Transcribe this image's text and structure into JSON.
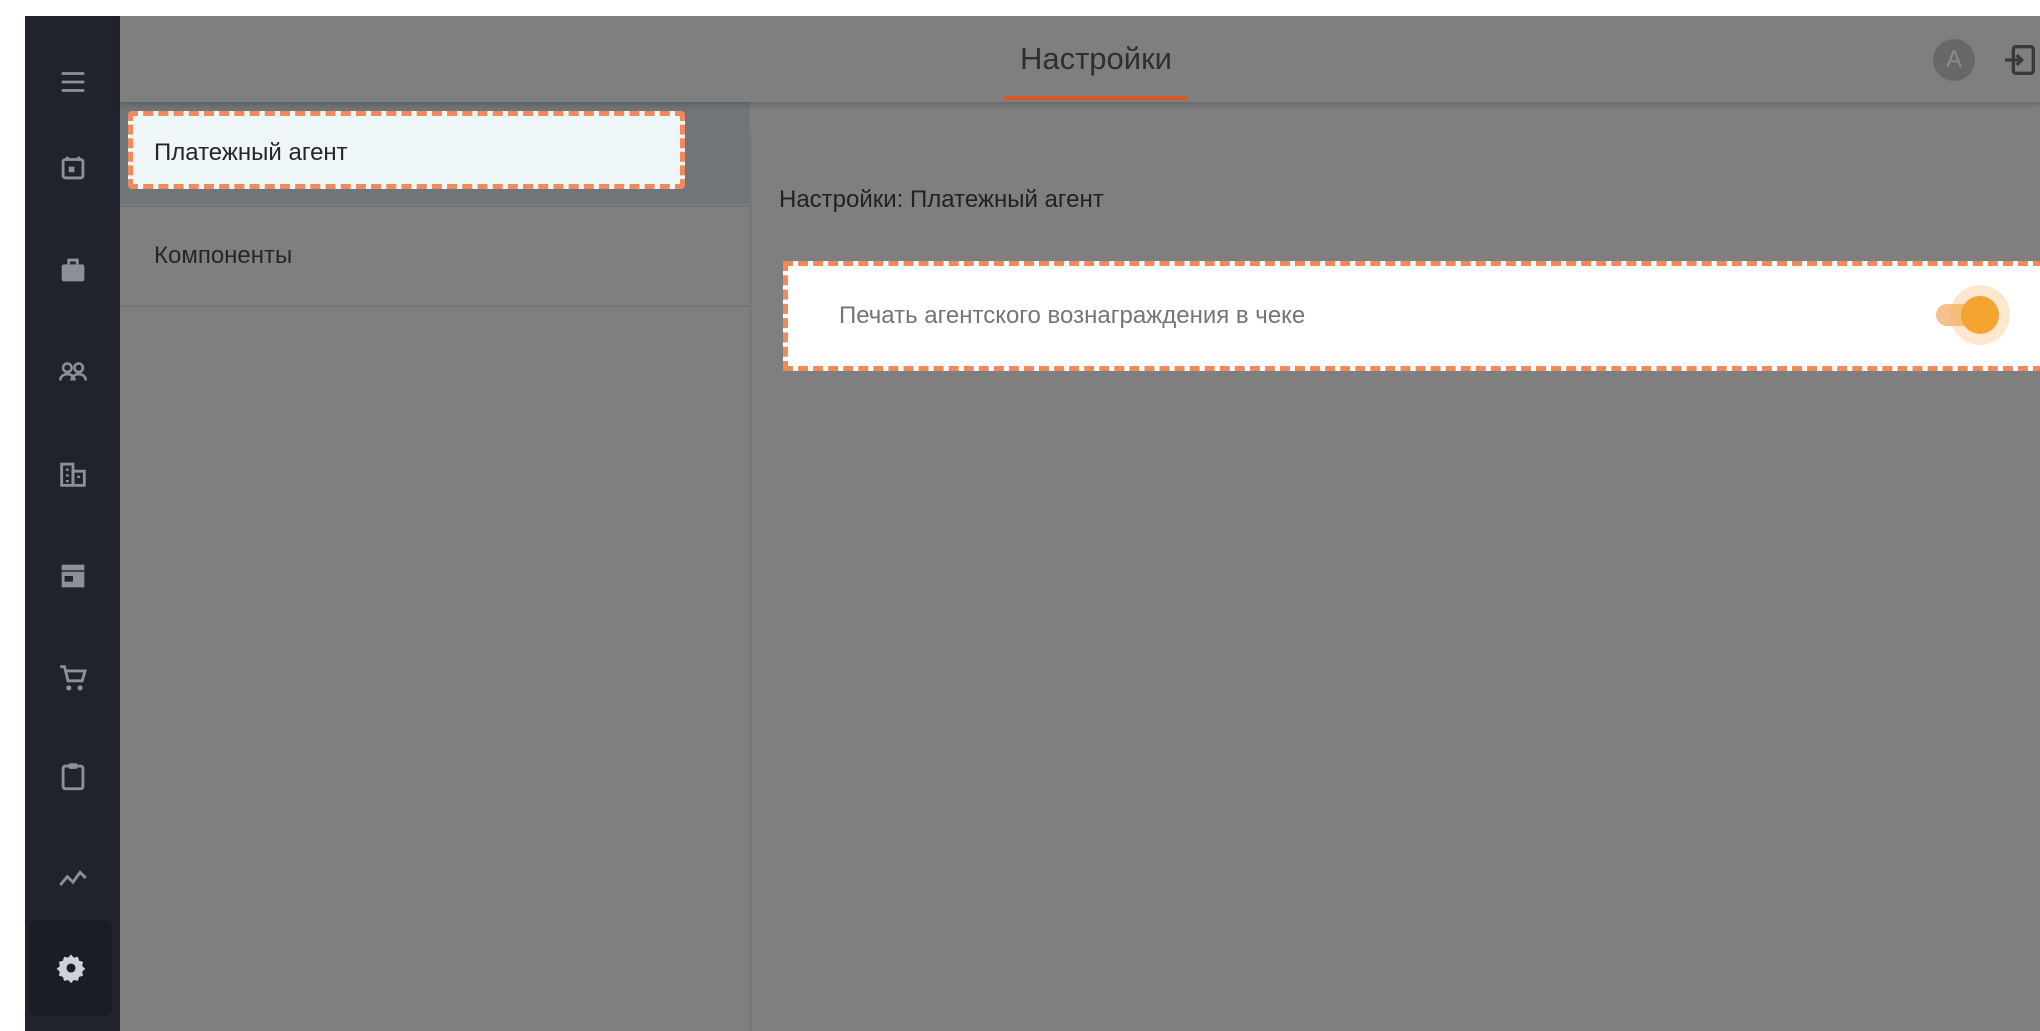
{
  "header": {
    "active_tab": "Настройки",
    "avatar_letter": "A"
  },
  "rail": {
    "items": [
      {
        "icon": "menu-icon"
      },
      {
        "icon": "calendar-icon"
      },
      {
        "icon": "briefcase-icon"
      },
      {
        "icon": "people-icon"
      },
      {
        "icon": "building-icon"
      },
      {
        "icon": "store-icon"
      },
      {
        "icon": "cart-icon"
      },
      {
        "icon": "clipboard-icon"
      },
      {
        "icon": "chart-line-icon"
      },
      {
        "icon": "gear-icon",
        "active": true
      }
    ]
  },
  "settings_menu": {
    "items": [
      {
        "label": "Платежный агент",
        "selected": true
      },
      {
        "label": "Компоненты",
        "selected": false
      }
    ]
  },
  "content": {
    "title": "Настройки: Платежный агент",
    "settings": [
      {
        "label": "Печать агентского вознаграждения в чеке",
        "enabled": true
      }
    ]
  },
  "colors": {
    "accent": "#d9582a",
    "highlight_border": "#f08a5d",
    "toggle_on": "#f5a331",
    "rail_bg": "#21232c"
  }
}
